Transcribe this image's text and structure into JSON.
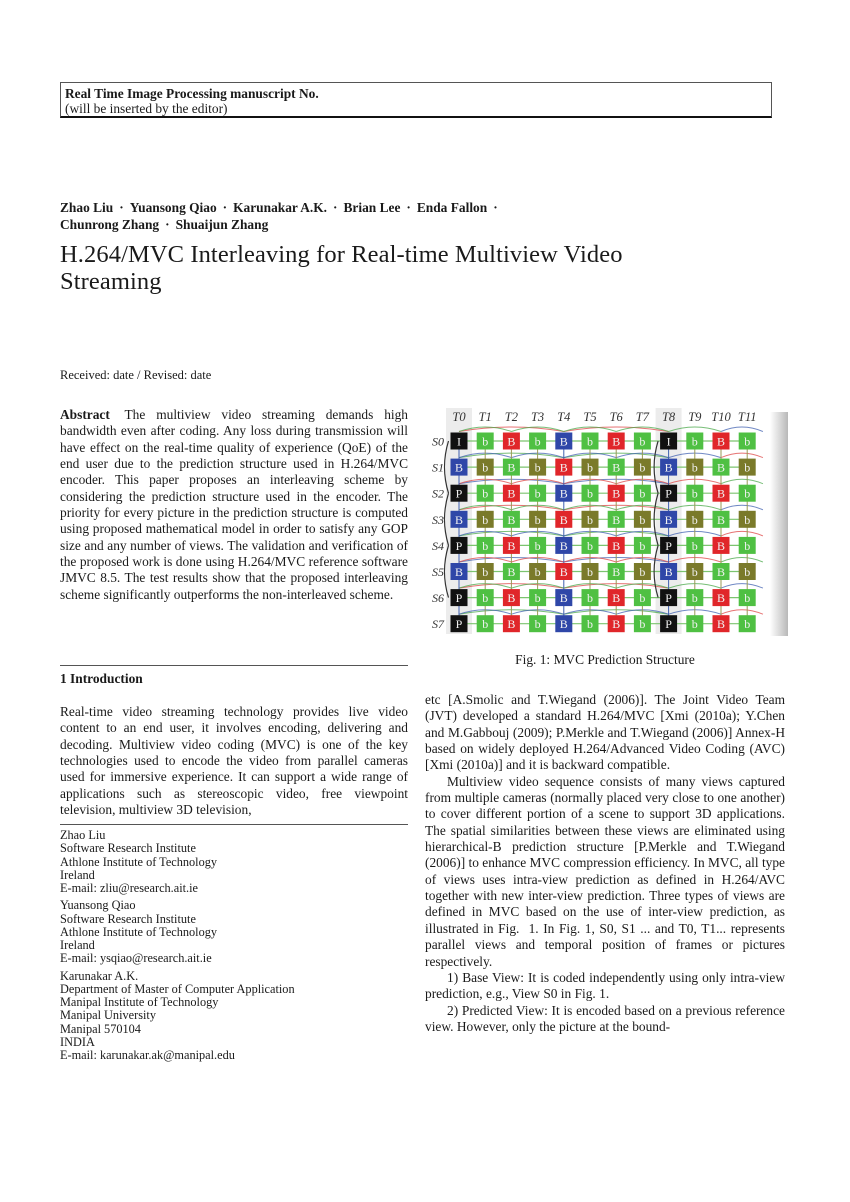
{
  "journal": {
    "name": "Real Time Image Processing manuscript No.",
    "note": "(will be inserted by the editor)"
  },
  "authors": {
    "line1": [
      "Zhao Liu",
      "Yuansong Qiao",
      "Karunakar A.K.",
      "Brian Lee",
      "Enda Fallon"
    ],
    "line2": [
      "Chunrong Zhang",
      "Shuaijun Zhang"
    ],
    "separator": "·"
  },
  "title": {
    "line1": "H.264/MVC Interleaving for Real-time Multiview Video",
    "line2": "Streaming"
  },
  "received": "Received: date / Revised: date",
  "abstract": {
    "label": "Abstract",
    "text": "The multiview video streaming demands high bandwidth even after coding. Any loss during transmis­sion will have effect on the real-time quality of experience (QoE) of the end user due to the prediction structure used in H.264/MVC encoder. This paper proposes an interleaving scheme by considering the prediction struc­ture used in the encoder. The priority for every picture in the prediction structure is computed using proposed mathematical model in order to satisfy any GOP size and any number of views. The validation and verification of the proposed work is done using H.264/MVC reference software JMVC 8.5. The test results show that the pro­posed interleaving scheme significantly outperforms the non-interleaved scheme."
  },
  "introduction": {
    "heading": "1 Introduction",
    "text_left": "Real-time video streaming technology provides live video content to an end user, it involves encoding, delivering and decoding. Multiview video coding (MVC) is one of the key technologies used to encode the video from par­allel cameras used for immersive experience. It can sup­port a wide range of applications such as stereoscopic video, free viewpoint television, multiview 3D television,",
    "text_right_p1": "etc [A.Smolic and T.Wiegand (2006)]. The Joint Video Team (JVT) developed a standard H.264/MVC [Xmi (2010a); Y.Chen and M.Gabbouj (2009); P.Merkle and T.Wiegand (2006)] Annex-H based on widely deployed H.264/Advanced Video Coding (AVC) [Xmi (2010a)] and it is backward compatible.",
    "text_right_p2": "Multiview video sequence consists of many views cap­tured from multiple cameras (normally placed very close to one another) to cover different portion of a scene to support 3D applications. The spatial similarities be­tween these views are eliminated using hierarchical-B prediction structure [P.Merkle and T.Wiegand (2006)] to enhance MVC compression efficiency. In MVC, all type of views uses intra-view prediction as defined in H.264/AVC together with new inter-view prediction. Three types of views are defined in MVC based on the use of inter-view prediction, as illustrated in Fig.  1. In Fig. 1, S0, S1 ... and T0, T1... represents parallel views and temporal position of frames or pictures respectively.",
    "text_right_p3": "1) Base View: It is coded independently using only intra-view prediction, e.g., View S0 in Fig. 1.",
    "text_right_p4": "2) Predicted View: It is encoded based on a previous reference view. However, only the picture at the bound-"
  },
  "affiliations": [
    {
      "lines": [
        "Zhao Liu",
        "Software Research Institute",
        "Athlone Institute of Technology",
        "Ireland",
        "E-mail: zliu@research.ait.ie"
      ]
    },
    {
      "lines": [
        "Yuansong Qiao",
        "Software Research Institute",
        "Athlone Institute of Technology",
        "Ireland",
        "E-mail: ysqiao@research.ait.ie"
      ]
    },
    {
      "lines": [
        "Karunakar A.K.",
        "Department of Master of Computer Application",
        "Manipal Institute of Technology",
        "Manipal University",
        "Manipal 570104",
        "INDIA",
        "E-mail: karunakar.ak@manipal.edu"
      ]
    }
  ],
  "figure": {
    "caption": "Fig. 1: MVC Prediction Structure",
    "time_labels": [
      "T0",
      "T1",
      "T2",
      "T3",
      "T4",
      "T5",
      "T6",
      "T7",
      "T8",
      "T9",
      "T10",
      "T11"
    ],
    "view_labels": [
      "S0",
      "S1",
      "S2",
      "S3",
      "S4",
      "S5",
      "S6",
      "S7"
    ],
    "frame_colors": {
      "K": "#111111",
      "R": "#e0262a",
      "U": "#2f47a8",
      "G": "#4fc043",
      "O": "#7a7a2a"
    },
    "grid": [
      [
        [
          "I",
          "K"
        ],
        [
          "b",
          "G"
        ],
        [
          "B",
          "R"
        ],
        [
          "b",
          "G"
        ],
        [
          "B",
          "U"
        ],
        [
          "b",
          "G"
        ],
        [
          "B",
          "R"
        ],
        [
          "b",
          "G"
        ],
        [
          "I",
          "K"
        ],
        [
          "b",
          "G"
        ],
        [
          "B",
          "R"
        ],
        [
          "b",
          "G"
        ]
      ],
      [
        [
          "B",
          "U"
        ],
        [
          "b",
          "O"
        ],
        [
          "B",
          "G"
        ],
        [
          "b",
          "O"
        ],
        [
          "B",
          "R"
        ],
        [
          "b",
          "O"
        ],
        [
          "B",
          "G"
        ],
        [
          "b",
          "O"
        ],
        [
          "B",
          "U"
        ],
        [
          "b",
          "O"
        ],
        [
          "B",
          "G"
        ],
        [
          "b",
          "O"
        ]
      ],
      [
        [
          "P",
          "K"
        ],
        [
          "b",
          "G"
        ],
        [
          "B",
          "R"
        ],
        [
          "b",
          "G"
        ],
        [
          "B",
          "U"
        ],
        [
          "b",
          "G"
        ],
        [
          "B",
          "R"
        ],
        [
          "b",
          "G"
        ],
        [
          "P",
          "K"
        ],
        [
          "b",
          "G"
        ],
        [
          "B",
          "R"
        ],
        [
          "b",
          "G"
        ]
      ],
      [
        [
          "B",
          "U"
        ],
        [
          "b",
          "O"
        ],
        [
          "B",
          "G"
        ],
        [
          "b",
          "O"
        ],
        [
          "B",
          "R"
        ],
        [
          "b",
          "O"
        ],
        [
          "B",
          "G"
        ],
        [
          "b",
          "O"
        ],
        [
          "B",
          "U"
        ],
        [
          "b",
          "O"
        ],
        [
          "B",
          "G"
        ],
        [
          "b",
          "O"
        ]
      ],
      [
        [
          "P",
          "K"
        ],
        [
          "b",
          "G"
        ],
        [
          "B",
          "R"
        ],
        [
          "b",
          "G"
        ],
        [
          "B",
          "U"
        ],
        [
          "b",
          "G"
        ],
        [
          "B",
          "R"
        ],
        [
          "b",
          "G"
        ],
        [
          "P",
          "K"
        ],
        [
          "b",
          "G"
        ],
        [
          "B",
          "R"
        ],
        [
          "b",
          "G"
        ]
      ],
      [
        [
          "B",
          "U"
        ],
        [
          "b",
          "O"
        ],
        [
          "B",
          "G"
        ],
        [
          "b",
          "O"
        ],
        [
          "B",
          "R"
        ],
        [
          "b",
          "O"
        ],
        [
          "B",
          "G"
        ],
        [
          "b",
          "O"
        ],
        [
          "B",
          "U"
        ],
        [
          "b",
          "O"
        ],
        [
          "B",
          "G"
        ],
        [
          "b",
          "O"
        ]
      ],
      [
        [
          "P",
          "K"
        ],
        [
          "b",
          "G"
        ],
        [
          "B",
          "R"
        ],
        [
          "b",
          "G"
        ],
        [
          "B",
          "U"
        ],
        [
          "b",
          "G"
        ],
        [
          "B",
          "R"
        ],
        [
          "b",
          "G"
        ],
        [
          "P",
          "K"
        ],
        [
          "b",
          "G"
        ],
        [
          "B",
          "R"
        ],
        [
          "b",
          "G"
        ]
      ],
      [
        [
          "P",
          "K"
        ],
        [
          "b",
          "G"
        ],
        [
          "B",
          "R"
        ],
        [
          "b",
          "G"
        ],
        [
          "B",
          "U"
        ],
        [
          "b",
          "G"
        ],
        [
          "B",
          "R"
        ],
        [
          "b",
          "G"
        ],
        [
          "P",
          "K"
        ],
        [
          "b",
          "G"
        ],
        [
          "B",
          "R"
        ],
        [
          "b",
          "G"
        ]
      ]
    ]
  }
}
